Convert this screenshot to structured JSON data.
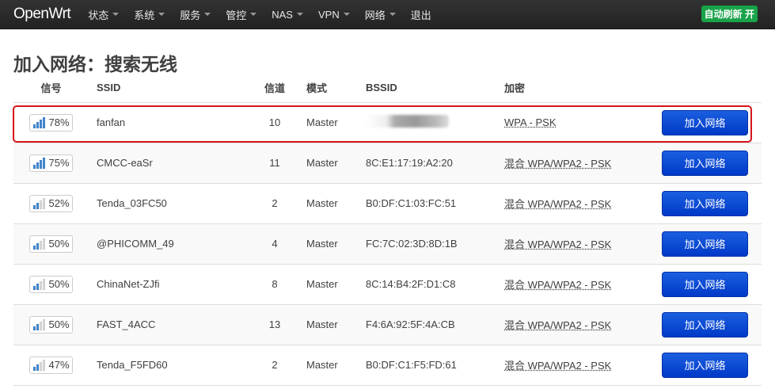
{
  "nav": {
    "brand": "OpenWrt",
    "items": [
      "状态",
      "系统",
      "服务",
      "管控",
      "NAS",
      "VPN",
      "网络"
    ],
    "logout": "退出",
    "refresh_badge": "自动刷新 开"
  },
  "page_title": "加入网络：搜索无线",
  "table": {
    "headers": [
      "信号",
      "SSID",
      "信道",
      "模式",
      "BSSID",
      "加密",
      ""
    ],
    "rows": [
      {
        "signal": "78%",
        "signal_level": 4,
        "ssid": "fanfan",
        "channel": "10",
        "mode": "Master",
        "bssid": "",
        "encryption": "WPA - PSK",
        "action": "加入网络",
        "highlighted": true
      },
      {
        "signal": "75%",
        "signal_level": 4,
        "ssid": "CMCC-eaSr",
        "channel": "11",
        "mode": "Master",
        "bssid": "8C:E1:17:19:A2:20",
        "encryption": "混合 WPA/WPA2 - PSK",
        "action": "加入网络"
      },
      {
        "signal": "52%",
        "signal_level": 2,
        "ssid": "Tenda_03FC50",
        "channel": "2",
        "mode": "Master",
        "bssid": "B0:DF:C1:03:FC:51",
        "encryption": "混合 WPA/WPA2 - PSK",
        "action": "加入网络"
      },
      {
        "signal": "50%",
        "signal_level": 2,
        "ssid": "@PHICOMM_49",
        "channel": "4",
        "mode": "Master",
        "bssid": "FC:7C:02:3D:8D:1B",
        "encryption": "混合 WPA/WPA2 - PSK",
        "action": "加入网络"
      },
      {
        "signal": "50%",
        "signal_level": 2,
        "ssid": "ChinaNet-ZJfi",
        "channel": "8",
        "mode": "Master",
        "bssid": "8C:14:B4:2F:D1:C8",
        "encryption": "混合 WPA/WPA2 - PSK",
        "action": "加入网络"
      },
      {
        "signal": "50%",
        "signal_level": 2,
        "ssid": "FAST_4ACC",
        "channel": "13",
        "mode": "Master",
        "bssid": "F4:6A:92:5F:4A:CB",
        "encryption": "混合 WPA/WPA2 - PSK",
        "action": "加入网络"
      },
      {
        "signal": "47%",
        "signal_level": 2,
        "ssid": "Tenda_F5FD60",
        "channel": "2",
        "mode": "Master",
        "bssid": "B0:DF:C1:F5:FD:61",
        "encryption": "混合 WPA/WPA2 - PSK",
        "action": "加入网络"
      }
    ]
  },
  "colors": {
    "accent": "#0039c8",
    "highlight": "#d5151b",
    "badge": "#1aa34a"
  }
}
